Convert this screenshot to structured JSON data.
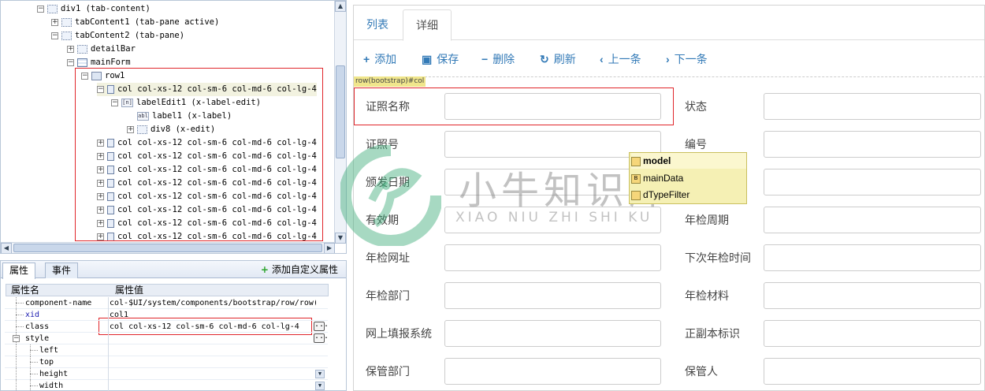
{
  "tree": {
    "nodes": [
      {
        "label": "div1 (tab-content)",
        "expander": "−",
        "icon": "dotted"
      },
      {
        "label": "tabContent1 (tab-pane active)",
        "expander": "+",
        "icon": "dotted"
      },
      {
        "label": "tabContent2 (tab-pane)",
        "expander": "−",
        "icon": "dotted"
      },
      {
        "label": "detailBar",
        "expander": "+",
        "icon": "dotted"
      },
      {
        "label": "mainForm",
        "expander": "−",
        "icon": "form"
      },
      {
        "label": "row1",
        "expander": "−",
        "icon": "solid"
      },
      {
        "label": "col col-xs-12 col-sm-6 col-md-6 col-lg-4",
        "expander": "−",
        "icon": "col",
        "selected": true
      },
      {
        "label": "labelEdit1 (x-label-edit)",
        "expander": "−",
        "icon": "lbl",
        "icon_text": "[n]"
      },
      {
        "label": "label1 (x-label)",
        "expander": "",
        "icon": "lbl",
        "icon_text": "abl"
      },
      {
        "label": "div8 (x-edit)",
        "expander": "+",
        "icon": "dotted"
      },
      {
        "label": "col col-xs-12 col-sm-6 col-md-6 col-lg-4",
        "expander": "+",
        "icon": "col"
      },
      {
        "label": "col col-xs-12 col-sm-6 col-md-6 col-lg-4",
        "expander": "+",
        "icon": "col"
      },
      {
        "label": "col col-xs-12 col-sm-6 col-md-6 col-lg-4",
        "expander": "+",
        "icon": "col"
      },
      {
        "label": "col col-xs-12 col-sm-6 col-md-6 col-lg-4",
        "expander": "+",
        "icon": "col"
      },
      {
        "label": "col col-xs-12 col-sm-6 col-md-6 col-lg-4",
        "expander": "+",
        "icon": "col"
      },
      {
        "label": "col col-xs-12 col-sm-6 col-md-6 col-lg-4",
        "expander": "+",
        "icon": "col"
      },
      {
        "label": "col col-xs-12 col-sm-6 col-md-6 col-lg-4",
        "expander": "+",
        "icon": "col"
      },
      {
        "label": "col col-xs-12 col-sm-6 col-md-6 col-lg-4",
        "expander": "+",
        "icon": "col"
      }
    ]
  },
  "props": {
    "tab_attributes": "属性",
    "tab_events": "事件",
    "add_custom": "添加自定义属性",
    "col_name": "属性名",
    "col_value": "属性值",
    "rows": [
      {
        "name": "component-name",
        "value": "col-$UI/system/components/bootstrap/row/row(bo",
        "level": 1,
        "blue": false
      },
      {
        "name": "xid",
        "value": "col1",
        "level": 1,
        "blue": true
      },
      {
        "name": "class",
        "value": "col col-xs-12 col-sm-6 col-md-6 col-lg-4",
        "level": 1,
        "blue": false,
        "dots": true
      },
      {
        "name": "style",
        "value": "",
        "level": 0,
        "blue": false,
        "expander": "−",
        "dots": true
      },
      {
        "name": "left",
        "value": "",
        "level": 2,
        "blue": false
      },
      {
        "name": "top",
        "value": "",
        "level": 2,
        "blue": false
      },
      {
        "name": "height",
        "value": "",
        "level": 2,
        "blue": false,
        "drop": true
      },
      {
        "name": "width",
        "value": "",
        "level": 2,
        "blue": false,
        "drop": true
      }
    ]
  },
  "detail": {
    "tabs": {
      "list": "列表",
      "detail": "详细"
    },
    "toolbar": {
      "add": "添加",
      "save": "保存",
      "delete": "删除",
      "refresh": "刷新",
      "prev": "上一条",
      "next": "下一条"
    },
    "row_tag": "row(bootstrap)#col",
    "fields_left": [
      "证照名称",
      "证照号",
      "颁发日期",
      "有效期",
      "年检网址",
      "年检部门",
      "网上填报系统",
      "保管部门"
    ],
    "fields_right": [
      "状态",
      "编号",
      "",
      "年检周期",
      "下次年检时间",
      "年检材料",
      "正副本标识",
      "保管人"
    ]
  },
  "popup": {
    "items": [
      "model",
      "mainData",
      "dTypeFilter"
    ]
  },
  "watermark": {
    "title": "小牛知识库",
    "subtitle": "XIAO NIU ZHI SHI KU"
  }
}
